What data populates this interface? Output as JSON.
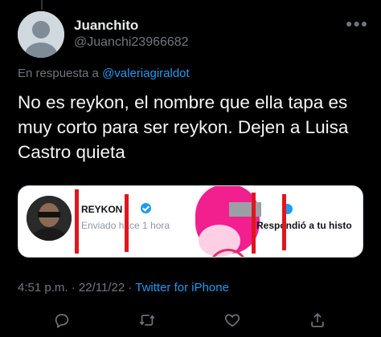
{
  "author": {
    "name": "Juanchito",
    "handle": "@Juanchi23966682"
  },
  "reply_prefix": "En respuesta a ",
  "reply_mention": "@valeriagiraldot",
  "tweet_text": "No es reykon, el nombre que ella tapa es muy corto para ser reykon. Dejen a Luisa Castro quieta",
  "attachment": {
    "left_name": "REYKON",
    "left_sent": "Enviado hace 1 hora",
    "right_text": "Respondió a tu histo"
  },
  "meta": {
    "time": "4:51 p.m.",
    "sep1": " · ",
    "date": "22/11/22",
    "sep2": " · ",
    "source": "Twitter for iPhone"
  },
  "icons": {
    "more": "more-icon",
    "reply": "reply-icon",
    "retweet": "retweet-icon",
    "like": "heart-icon",
    "share": "share-icon"
  },
  "colors": {
    "background": "#000000",
    "link": "#1d9bf0",
    "muted": "#71767b",
    "text": "#e7e9ea",
    "redact": "#e0161e"
  }
}
